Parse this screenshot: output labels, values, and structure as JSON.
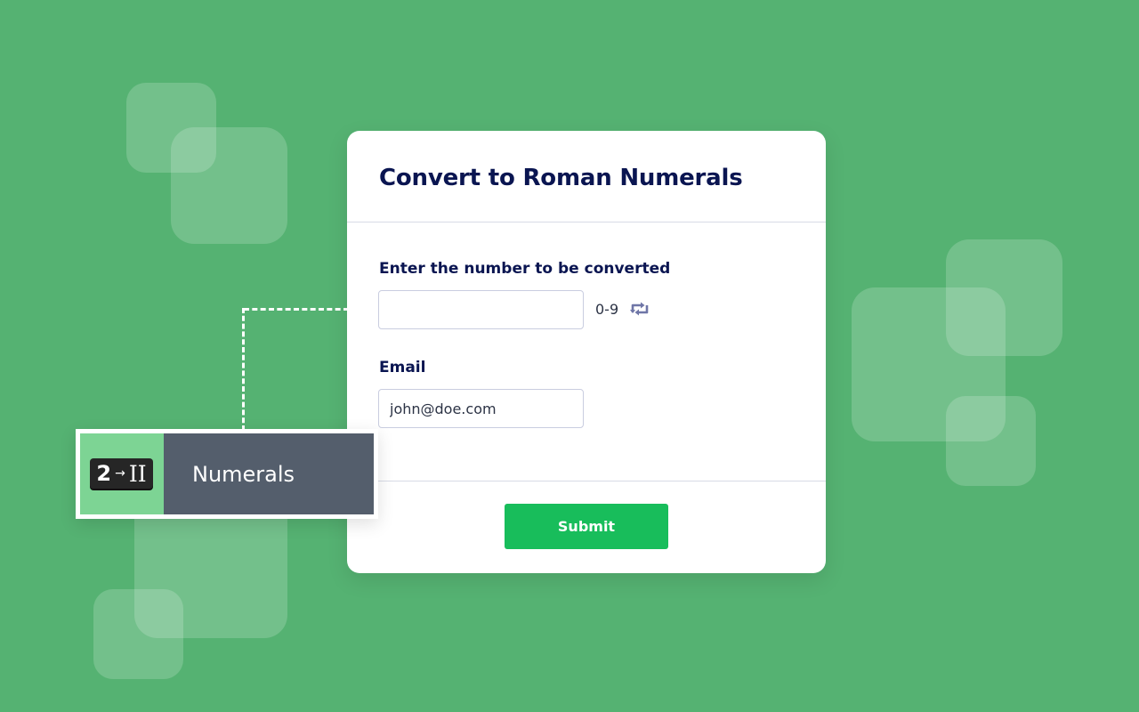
{
  "form": {
    "title": "Convert to Roman Numerals",
    "number_field": {
      "label": "Enter the number to be converted",
      "value": "",
      "placeholder": "",
      "hint": "0-9"
    },
    "email_field": {
      "label": "Email",
      "value": "john@doe.com",
      "placeholder": ""
    },
    "submit_label": "Submit"
  },
  "widget": {
    "badge_number": "2",
    "badge_arrow": "→",
    "badge_roman": "II",
    "name": "Numerals"
  },
  "colors": {
    "background": "#55b272",
    "title_text": "#0a1551",
    "submit": "#18bd5b",
    "widget_icon_bg": "#7dd494",
    "widget_name_bg": "#545e6c",
    "retweet_icon": "#6f76a7"
  },
  "icons": {
    "swap": "retweet-icon"
  }
}
